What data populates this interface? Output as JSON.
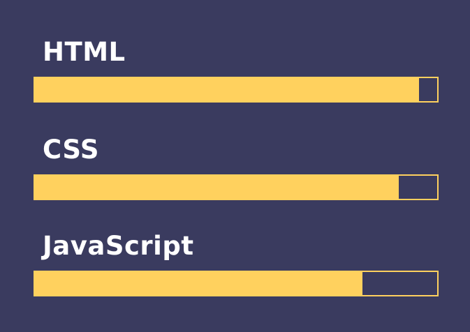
{
  "skills": [
    {
      "label": "HTML",
      "level": 0.955
    },
    {
      "label": "CSS",
      "level": 0.905
    },
    {
      "label": "JavaScript",
      "level": 0.815
    }
  ],
  "colors": {
    "background": "#3a3b5f",
    "bar": "#ffd15e",
    "text": "#ffffff"
  }
}
